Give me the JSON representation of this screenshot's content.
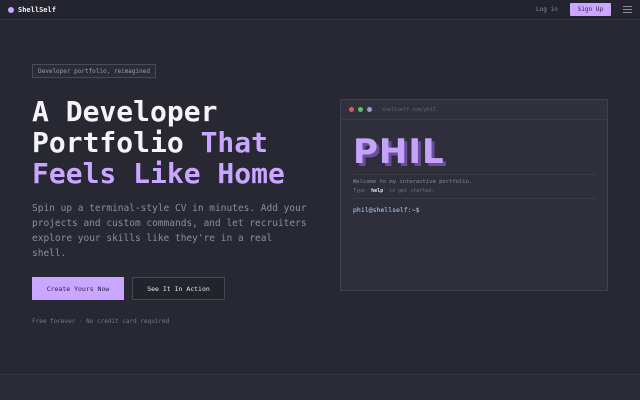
{
  "nav": {
    "brand": "ShellSelf",
    "login": "Log in",
    "signup": "Sign Up",
    "menu_icon": "menu-icon"
  },
  "hero": {
    "badge": "Developer portfolio, reimagined",
    "headline_line1": "A Developer",
    "headline_line2_plain": "Portfolio ",
    "headline_line2_accent": "That",
    "headline_line3_accent": "Feels Like Home",
    "subtitle": "Spin up a terminal-style CV in minutes. Add your projects and custom commands, and let recruiters explore your skills like they're in a real shell.",
    "cta_primary": "Create Yours Now",
    "cta_secondary": "See It In Action",
    "fine_print": "Free forever · No credit card required"
  },
  "terminal": {
    "url": "shellself.com/phil",
    "ascii_name": "PHIL",
    "welcome": "Welcome to my interactive portfolio.",
    "hint_pre": "Type '",
    "hint_cmd": "help",
    "hint_post": "' to get started.",
    "prompt": "phil@shellself:~$",
    "dot_colors": [
      "#e0595a",
      "#5fc06a",
      "#9aa0c4"
    ]
  },
  "colors": {
    "accent": "#c9a6ff",
    "background": "#272832"
  }
}
